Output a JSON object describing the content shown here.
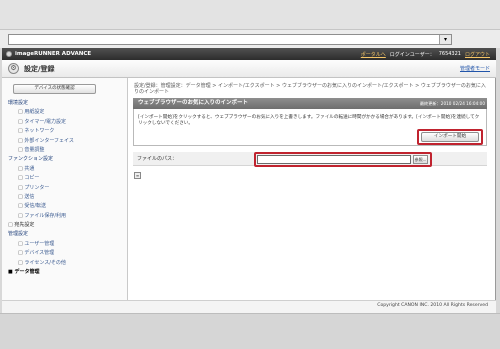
{
  "browser": {
    "address_value": ""
  },
  "topbar": {
    "brand": "imageRUNNER ADVANCE",
    "portal_link": "ポータルへ",
    "login_user_label": "ログインユーザー：",
    "login_user": "7654321",
    "logout": "ログアウト"
  },
  "header": {
    "title": "設定/登録",
    "manager_mode": "管理者モード"
  },
  "sidebar": {
    "device_status_button": "デバイスの状態確認",
    "items": [
      {
        "label": "環境設定",
        "kind": "cat"
      },
      {
        "label": "用紙設定",
        "kind": "sub"
      },
      {
        "label": "タイマー/電力設定",
        "kind": "sub"
      },
      {
        "label": "ネットワーク",
        "kind": "sub"
      },
      {
        "label": "外部インターフェイス",
        "kind": "sub"
      },
      {
        "label": "音量調整",
        "kind": "sub"
      },
      {
        "label": "ファンクション設定",
        "kind": "cat"
      },
      {
        "label": "共通",
        "kind": "sub"
      },
      {
        "label": "コピー",
        "kind": "sub"
      },
      {
        "label": "プリンター",
        "kind": "sub"
      },
      {
        "label": "送信",
        "kind": "sub"
      },
      {
        "label": "受信/転送",
        "kind": "sub"
      },
      {
        "label": "ファイル保存/利用",
        "kind": "sub"
      },
      {
        "label": "宛先設定",
        "kind": "top"
      },
      {
        "label": "管理設定",
        "kind": "cat"
      },
      {
        "label": "ユーザー管理",
        "kind": "sub"
      },
      {
        "label": "デバイス管理",
        "kind": "sub"
      },
      {
        "label": "ライセンス/その他",
        "kind": "sub"
      },
      {
        "label": "データ管理",
        "kind": "active"
      }
    ]
  },
  "main": {
    "breadcrumb": "設定/登録：管理設定：データ管理 > インポート/エクスポート > ウェブブラウザーのお気に入りのインポート/エクスポート > ウェブブラウザーのお気に入りのインポート",
    "panel_title": "ウェブブラウザーのお気に入りのインポート",
    "panel_time": "最終更新：2010 02/24 16:04:00",
    "description": "[インポート開始]をクリックすると、ウェブブラウザーのお気に入りを上書きします。ファイルの転送に時間がかかる場合があります。[インポート開始]を連続してクリックしないでください。",
    "import_button": "インポート開始",
    "file_path_label": "ファイルのパス：",
    "file_path_value": "",
    "browse_button": "参照..."
  },
  "footer": {
    "copyright": "Copyright CANON INC. 2010 All Rights Reserved"
  },
  "colors": {
    "highlight": "#c0232f",
    "topbar": "#3a3a3a",
    "link": "#2255aa"
  }
}
